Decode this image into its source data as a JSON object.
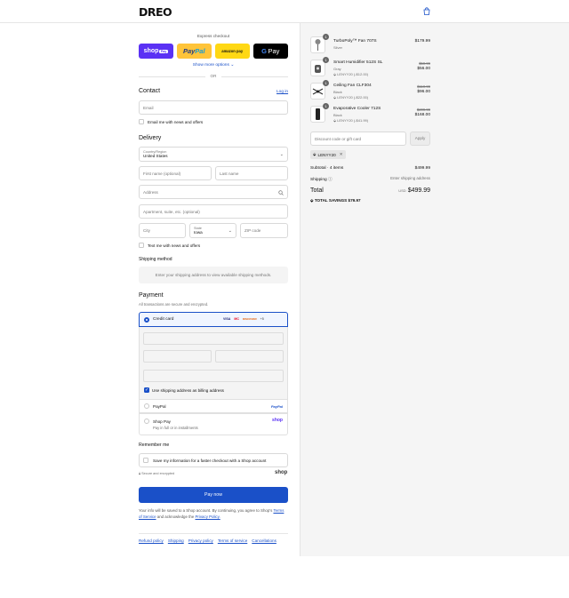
{
  "header": {
    "logo": "DREO",
    "cart_icon": "shopping-bag-icon"
  },
  "express": {
    "label": "Express checkout",
    "shop_pay": "shop",
    "shop_pay_pill": "Pay",
    "paypal_a": "Pay",
    "paypal_b": "Pal",
    "amazon_pay": "amazon pay",
    "gpay": "Pay",
    "gpay_g": "G",
    "more": "Show more options",
    "or": "OR"
  },
  "contact": {
    "heading": "Contact",
    "login": "Log in",
    "email_placeholder": "Email",
    "news_label": "Email me with news and offers"
  },
  "delivery": {
    "heading": "Delivery",
    "country_label": "Country/Region",
    "country_value": "United States",
    "first_name": "First name (optional)",
    "last_name": "Last name",
    "address": "Address",
    "apartment": "Apartment, suite, etc. (optional)",
    "city": "City",
    "state_label": "State",
    "state_value": "Iowa",
    "zip": "ZIP code",
    "text_news": "Text me with news and offers"
  },
  "shipping": {
    "heading": "Shipping method",
    "placeholder": "Enter your shipping address to view available shipping methods."
  },
  "payment": {
    "heading": "Payment",
    "subtitle": "All transactions are secure and encrypted.",
    "credit_card": "Credit card",
    "card_brands": [
      "VISA",
      "MC",
      "DISCOVER",
      "+5"
    ],
    "use_shipping": "Use shipping address as billing address",
    "paypal": "PayPal",
    "paypal_logo": "PayPal",
    "shop_pay": "Shop Pay",
    "shop_pay_sub": "Pay in full or in installments",
    "shop_logo": "shop"
  },
  "remember": {
    "heading": "Remember me",
    "save_label": "Save my information for a faster checkout with a Shop account",
    "secure": "Secure and encrypted",
    "shop_logo": "shop"
  },
  "pay_now": "Pay now",
  "legal": {
    "text_a": "Your info will be saved to a Shop account. By continuing, you agree to Shop's",
    "tos": "Terms of Service",
    "text_b": "and acknowledge the",
    "privacy": "Privacy Policy."
  },
  "footer_links": [
    "Refund policy",
    "Shipping",
    "Privacy policy",
    "Terms of service",
    "Cancellations"
  ],
  "cart": {
    "items": [
      {
        "qty": "1",
        "name": "TurboPoly™ Fan 707S",
        "variant": "Silver",
        "code": "",
        "old_price": "",
        "price": "$179.99"
      },
      {
        "qty": "1",
        "name": "Smart Humidifier 512S SL",
        "variant": "Gray",
        "code": "LENYY20 (-$12.00)",
        "old_price": "$59.99",
        "price": "$56.00"
      },
      {
        "qty": "1",
        "name": "Ceiling Fan CLF304",
        "variant": "Black",
        "code": "LENYY20 (-$22.00)",
        "old_price": "$119.99",
        "price": "$96.00"
      },
      {
        "qty": "1",
        "name": "Evaporative Cooler 712S",
        "variant": "Black",
        "code": "LENYY20 (-$41.99)",
        "old_price": "$209.99",
        "price": "$168.00"
      }
    ],
    "discount_placeholder": "Discount code or gift card",
    "apply": "Apply",
    "applied_code": "LENYY20",
    "subtotal_label": "Subtotal · 4 items",
    "subtotal": "$499.99",
    "shipping_label": "Shipping",
    "shipping_value": "Enter shipping address",
    "total_label": "Total",
    "currency": "USD",
    "total": "$499.99",
    "savings": "TOTAL SAVINGS $79.97"
  },
  "colors": {
    "accent": "#1a50c8",
    "shop_pay": "#5a31f4",
    "paypal": "#ffc439",
    "amazon": "#ffd814"
  }
}
